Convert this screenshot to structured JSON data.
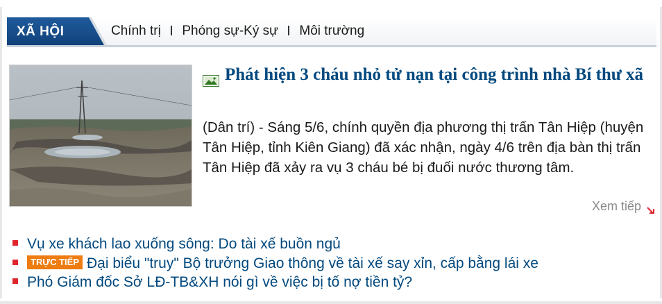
{
  "header": {
    "section": "XÃ HỘI",
    "subnav": [
      "Chính trị",
      "Phóng sự-Ký sự",
      "Môi trường"
    ]
  },
  "article": {
    "title": "Phát hiện 3 cháu nhỏ tử nạn tại công trình nhà Bí thư xã",
    "summary": "(Dân trí) - Sáng 5/6, chính quyền địa phương thị trấn Tân Hiệp (huyện Tân Hiệp, tỉnh Kiên Giang) đã xác nhận, ngày 4/6 trên địa bàn thị trấn Tân Hiệp đã xảy ra vụ 3 cháu bé bị đuối nước thương tâm.",
    "read_more": "Xem tiếp",
    "title_icon": "photo-icon"
  },
  "related": [
    {
      "badge": "",
      "text": "Vụ xe khách lao xuống sông: Do tài xế buồn ngủ"
    },
    {
      "badge": "TRỰC TIẾP",
      "text": "Đại biểu \"truy\" Bộ trưởng Giao thông về tài xế say xỉn, cấp bằng lái xe"
    },
    {
      "badge": "",
      "text": "Phó Giám đốc Sở LĐ-TB&XH nói gì về việc bị tố nợ tiền tỷ?"
    }
  ],
  "colors": {
    "brand_blue": "#11427a",
    "link_blue": "#00487e",
    "bullet_red": "#e0262b",
    "live_orange": "#ee7c10"
  }
}
